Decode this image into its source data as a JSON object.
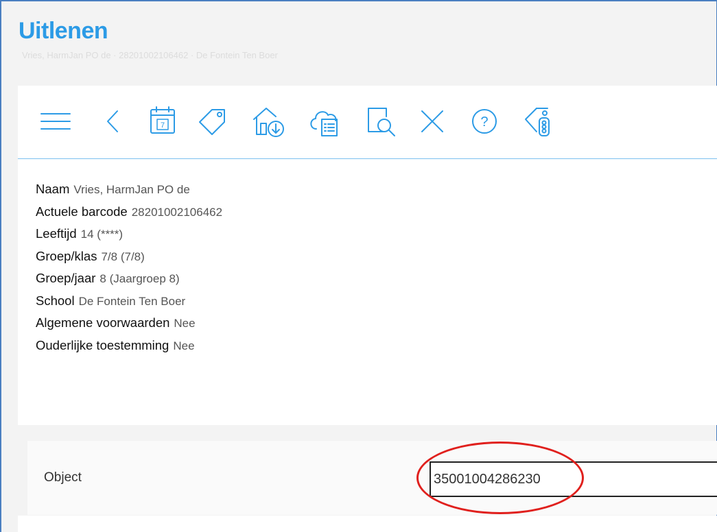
{
  "header": {
    "title": "Uitlenen",
    "subtitle": "Vries, HarmJan PO de  ·  28201002106462  ·  De Fontein Ten Boer"
  },
  "toolbar": {
    "icons": [
      "menu-icon",
      "chevron-left-icon",
      "calendar-icon",
      "tag-icon",
      "home-download-icon",
      "cloud-list-icon",
      "search-document-icon",
      "close-icon",
      "help-icon",
      "tag-traffic-light-icon"
    ],
    "calendar_day": "7",
    "help_glyph": "?"
  },
  "patron": {
    "naam": {
      "label": "Naam",
      "value": "Vries, HarmJan PO de"
    },
    "barcode": {
      "label": "Actuele barcode",
      "value": "28201002106462"
    },
    "leeftijd": {
      "label": "Leeftijd",
      "value": "14 (****)"
    },
    "groep_klas": {
      "label": "Groep/klas",
      "value": "7/8 (7/8)"
    },
    "groep_jaar": {
      "label": "Groep/jaar",
      "value": "8 (Jaargroep 8)"
    },
    "school": {
      "label": "School",
      "value": "De Fontein Ten Boer"
    },
    "voorwaarden": {
      "label": "Algemene voorwaarden",
      "value": "Nee"
    },
    "toestemming": {
      "label": "Ouderlijke toestemming",
      "value": "Nee"
    }
  },
  "object": {
    "label": "Object",
    "value": "35001004286230"
  },
  "colors": {
    "accent": "#2c9be6",
    "highlight": "#e0201d"
  }
}
